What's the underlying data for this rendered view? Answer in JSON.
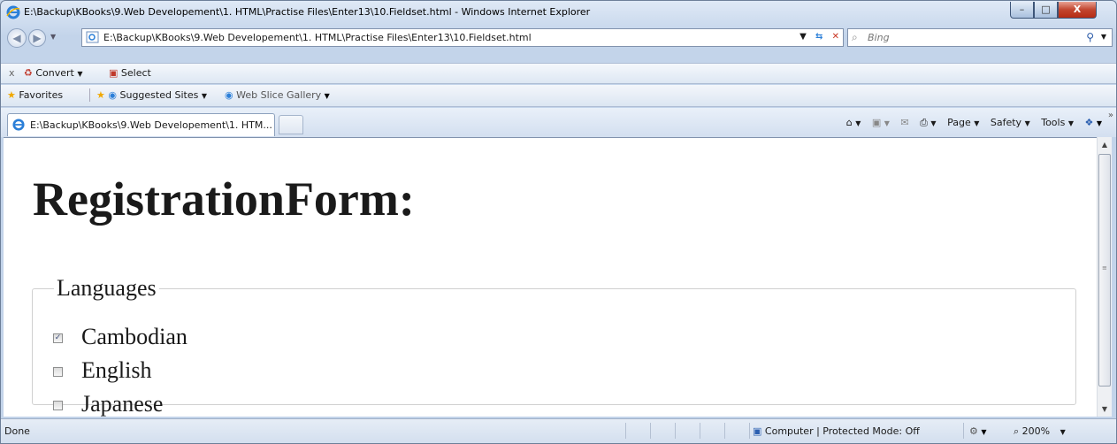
{
  "window": {
    "title": "E:\\Backup\\KBooks\\9.Web Developement\\1. HTML\\Practise Files\\Enter13\\10.Fieldset.html - Windows Internet Explorer",
    "min_glyph": "–",
    "max_glyph": "□",
    "close_glyph": "X"
  },
  "address_bar": {
    "url": "E:\\Backup\\KBooks\\9.Web Developement\\1. HTML\\Practise Files\\Enter13\\10.Fieldset.html",
    "search_placeholder": "Bing"
  },
  "command_bar": {
    "close_glyph": "x",
    "convert_label": "Convert",
    "select_label": "Select"
  },
  "favorites_bar": {
    "favorites_label": "Favorites",
    "suggested_sites_label": "Suggested Sites",
    "web_slice_label": "Web Slice Gallery"
  },
  "tab": {
    "label": "E:\\Backup\\KBooks\\9.Web Developement\\1. HTM..."
  },
  "toolbar": {
    "page_label": "Page",
    "safety_label": "Safety",
    "tools_label": "Tools"
  },
  "page": {
    "heading": "RegistrationForm:",
    "fieldset_legend": "Languages",
    "options": [
      {
        "label": "Cambodian",
        "checked": true
      },
      {
        "label": "English",
        "checked": false
      },
      {
        "label": "Japanese",
        "checked": false
      }
    ]
  },
  "status_bar": {
    "status": "Done",
    "zone": "Computer | Protected Mode: Off",
    "zoom": "200%"
  }
}
